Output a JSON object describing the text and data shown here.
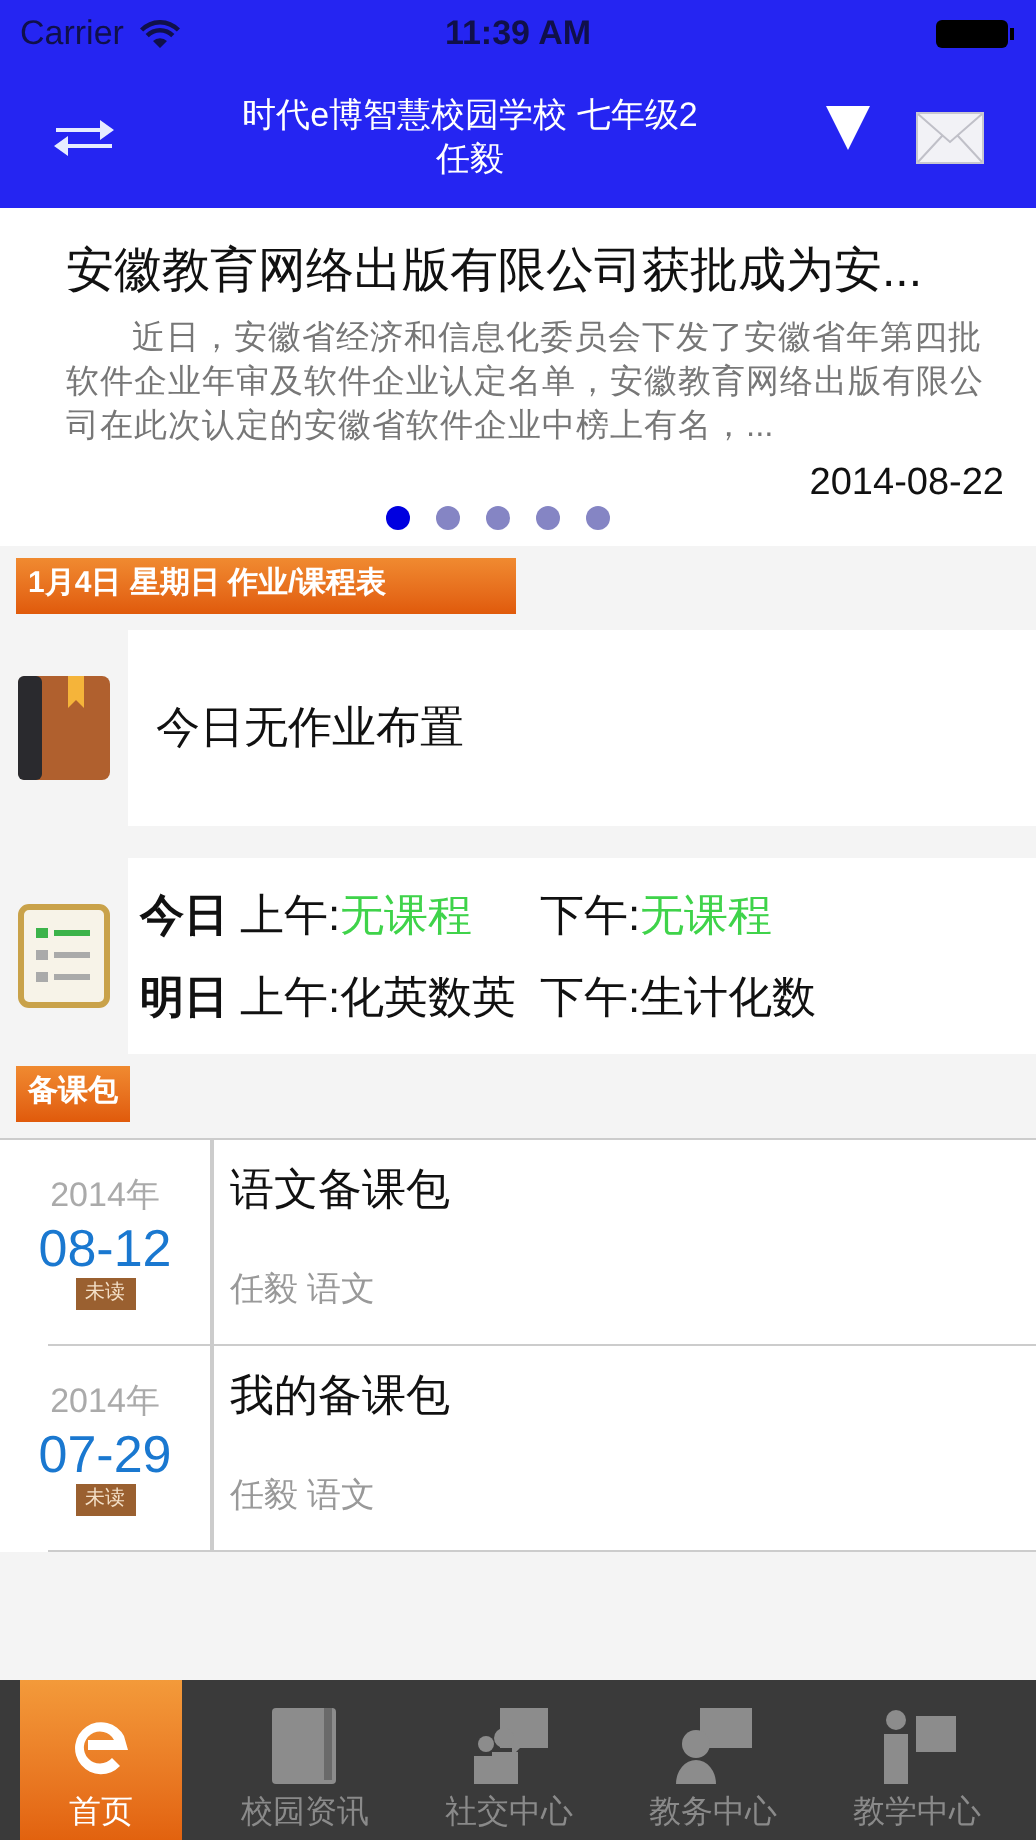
{
  "status_bar": {
    "carrier": "Carrier",
    "time": "11:39 AM"
  },
  "nav_bar": {
    "title": "时代e博智慧校园学校 七年级2",
    "subtitle": "任毅"
  },
  "news": {
    "title": "安徽教育网络出版有限公司获批成为安...",
    "summary": "近日，安徽省经济和信息化委员会下发了安徽省年第四批软件企业年审及软件企业认定名单，安徽教育网络出版有限公司在此次认定的安徽省软件企业中榜上有名，...",
    "date": "2014-08-22",
    "pages": [
      {
        "selected": true
      },
      {
        "selected": false
      },
      {
        "selected": false
      },
      {
        "selected": false
      },
      {
        "selected": false
      }
    ]
  },
  "homework_section": {
    "label": "1月4日 星期日 作业/课程表",
    "homework": "今日无作业布置",
    "schedule": [
      {
        "day": "今日",
        "am_label": "上午:",
        "am": "无课程",
        "am_empty": true,
        "pm_label": "下午:",
        "pm": "无课程",
        "pm_empty": true
      },
      {
        "day": "明日",
        "am_label": "上午:",
        "am": "化英数英",
        "am_empty": false,
        "pm_label": "下午:",
        "pm": "生计化数",
        "pm_empty": false
      }
    ]
  },
  "lesson_packs": {
    "label": "备课包",
    "items": [
      {
        "year": "2014年",
        "date": "08-12",
        "badge": "未读",
        "title": "语文备课包",
        "meta": "任毅 语文"
      },
      {
        "year": "2014年",
        "date": "07-29",
        "badge": "未读",
        "title": "我的备课包",
        "meta": "任毅 语文"
      }
    ]
  },
  "tab_bar": [
    {
      "kind": "home",
      "label": "首页",
      "selected": true
    },
    {
      "kind": "news",
      "label": "校园资讯",
      "selected": false
    },
    {
      "kind": "social",
      "label": "社交中心",
      "selected": false
    },
    {
      "kind": "affairs",
      "label": "教务中心",
      "selected": false
    },
    {
      "kind": "teaching",
      "label": "教学中心",
      "selected": false
    }
  ]
}
